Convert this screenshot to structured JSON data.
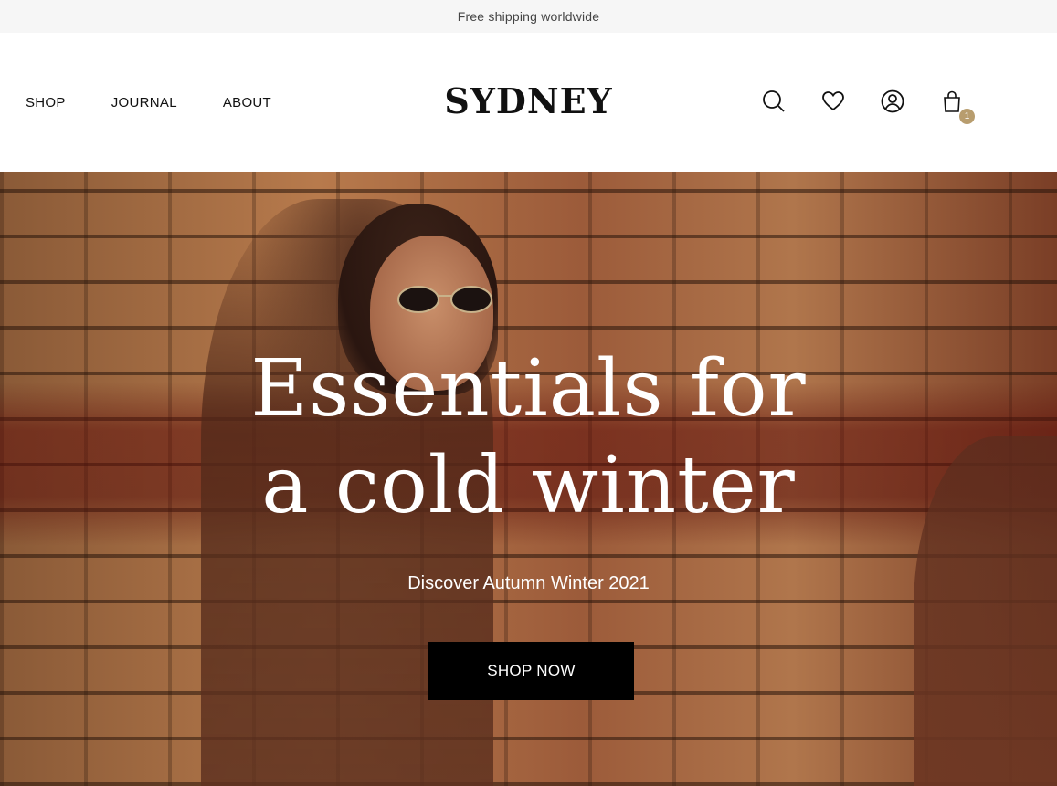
{
  "announcement": "Free shipping worldwide",
  "nav": [
    {
      "label": "SHOP"
    },
    {
      "label": "JOURNAL"
    },
    {
      "label": "ABOUT"
    }
  ],
  "brand": "SYDNEY",
  "header_icons": [
    "search-icon",
    "heart-icon",
    "user-icon",
    "bag-icon"
  ],
  "cart_count": "1",
  "hero": {
    "title_line1": "Essentials for",
    "title_line2": "a cold winter",
    "subtitle": "Discover Autumn Winter 2021",
    "cta_label": "SHOP NOW"
  },
  "colors": {
    "badge": "#b89d6e",
    "cta_bg": "#000000",
    "announcement_bg": "#f6f6f6"
  }
}
